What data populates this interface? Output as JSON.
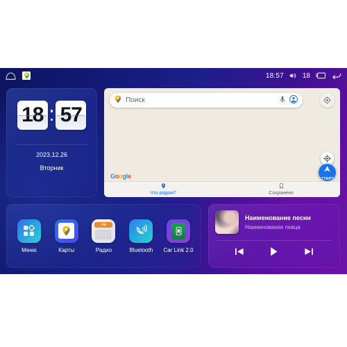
{
  "statusbar": {
    "home_icon": "home-icon",
    "maps_icon": "maps-pin-icon",
    "time": "18:57",
    "volume_icon": "volume-icon",
    "volume_level": "18",
    "recents_icon": "recent-apps-icon",
    "back_icon": "back-arrow-icon"
  },
  "clock": {
    "hours": "18",
    "minutes": "57",
    "date": "2023.12.26",
    "weekday": "Вторник"
  },
  "maps": {
    "search": {
      "placeholder": "Поиск",
      "value": "Поиск",
      "pin_icon": "maps-pin-icon",
      "mic_icon": "microphone-icon",
      "account_icon": "account-avatar-icon"
    },
    "gear_icon": "gear-icon",
    "locate_icon": "compass-locate-icon",
    "start_label": "СТАРТ",
    "start_icon": "navigation-arrow-icon",
    "brand": "Google",
    "tabs": [
      {
        "label": "Что рядом?",
        "icon": "location-pin-icon",
        "active": true
      },
      {
        "label": "Сохранено",
        "icon": "bookmark-icon",
        "active": false
      }
    ]
  },
  "apps": [
    {
      "label": "Меню",
      "icon": "menu-grid-icon"
    },
    {
      "label": "Карты",
      "icon": "maps-pin-icon"
    },
    {
      "label": "Радио",
      "icon": "radio-icon",
      "badge": "FM"
    },
    {
      "label": "Bluetooth",
      "icon": "bluetooth-phone-icon"
    },
    {
      "label": "Car Link 2.0",
      "icon": "car-link-icon"
    }
  ],
  "media": {
    "title": "Наименование песни",
    "artist": "Наименование певца",
    "album_art": "album-art-portrait",
    "controls": [
      {
        "name": "previous-track-button",
        "icon": "skip-previous-icon"
      },
      {
        "name": "play-button",
        "icon": "play-icon"
      },
      {
        "name": "next-track-button",
        "icon": "skip-next-icon"
      }
    ]
  },
  "colors": {
    "accent_blue": "#1a73e8",
    "bg_blue": "#141a78",
    "bg_purple": "#6b12a6",
    "map_bg": "#efebe2",
    "radio_orange": "#f08a28"
  }
}
